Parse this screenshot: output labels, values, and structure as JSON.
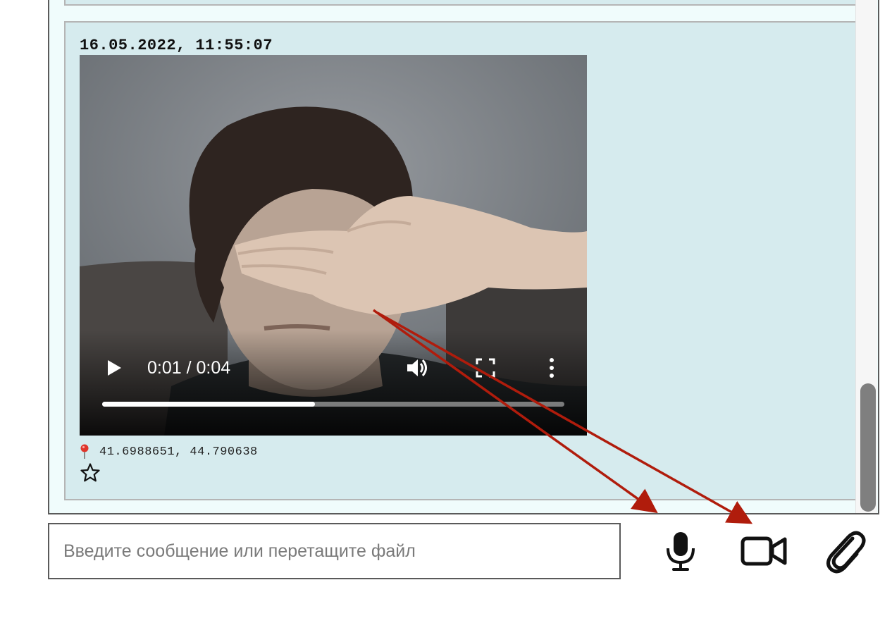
{
  "message": {
    "timestamp": "16.05.2022, 11:55:07",
    "location": "41.6988651, 44.790638"
  },
  "video_player": {
    "time_display": "0:01 / 0:04",
    "progress_fraction": 0.46
  },
  "composer": {
    "placeholder": "Введите сообщение или перетащите файл",
    "value": ""
  },
  "icons": {
    "pin": "map-pin-icon",
    "star": "star-outline-icon",
    "play": "play-icon",
    "volume": "volume-icon",
    "fullscreen": "fullscreen-icon",
    "more": "more-vertical-icon",
    "mic": "microphone-icon",
    "video": "video-camera-icon",
    "attach": "paperclip-icon"
  },
  "colors": {
    "panel_background": "#f0fcfc",
    "message_background": "#d6ebee",
    "annotation_arrow": "#b01c0c"
  }
}
